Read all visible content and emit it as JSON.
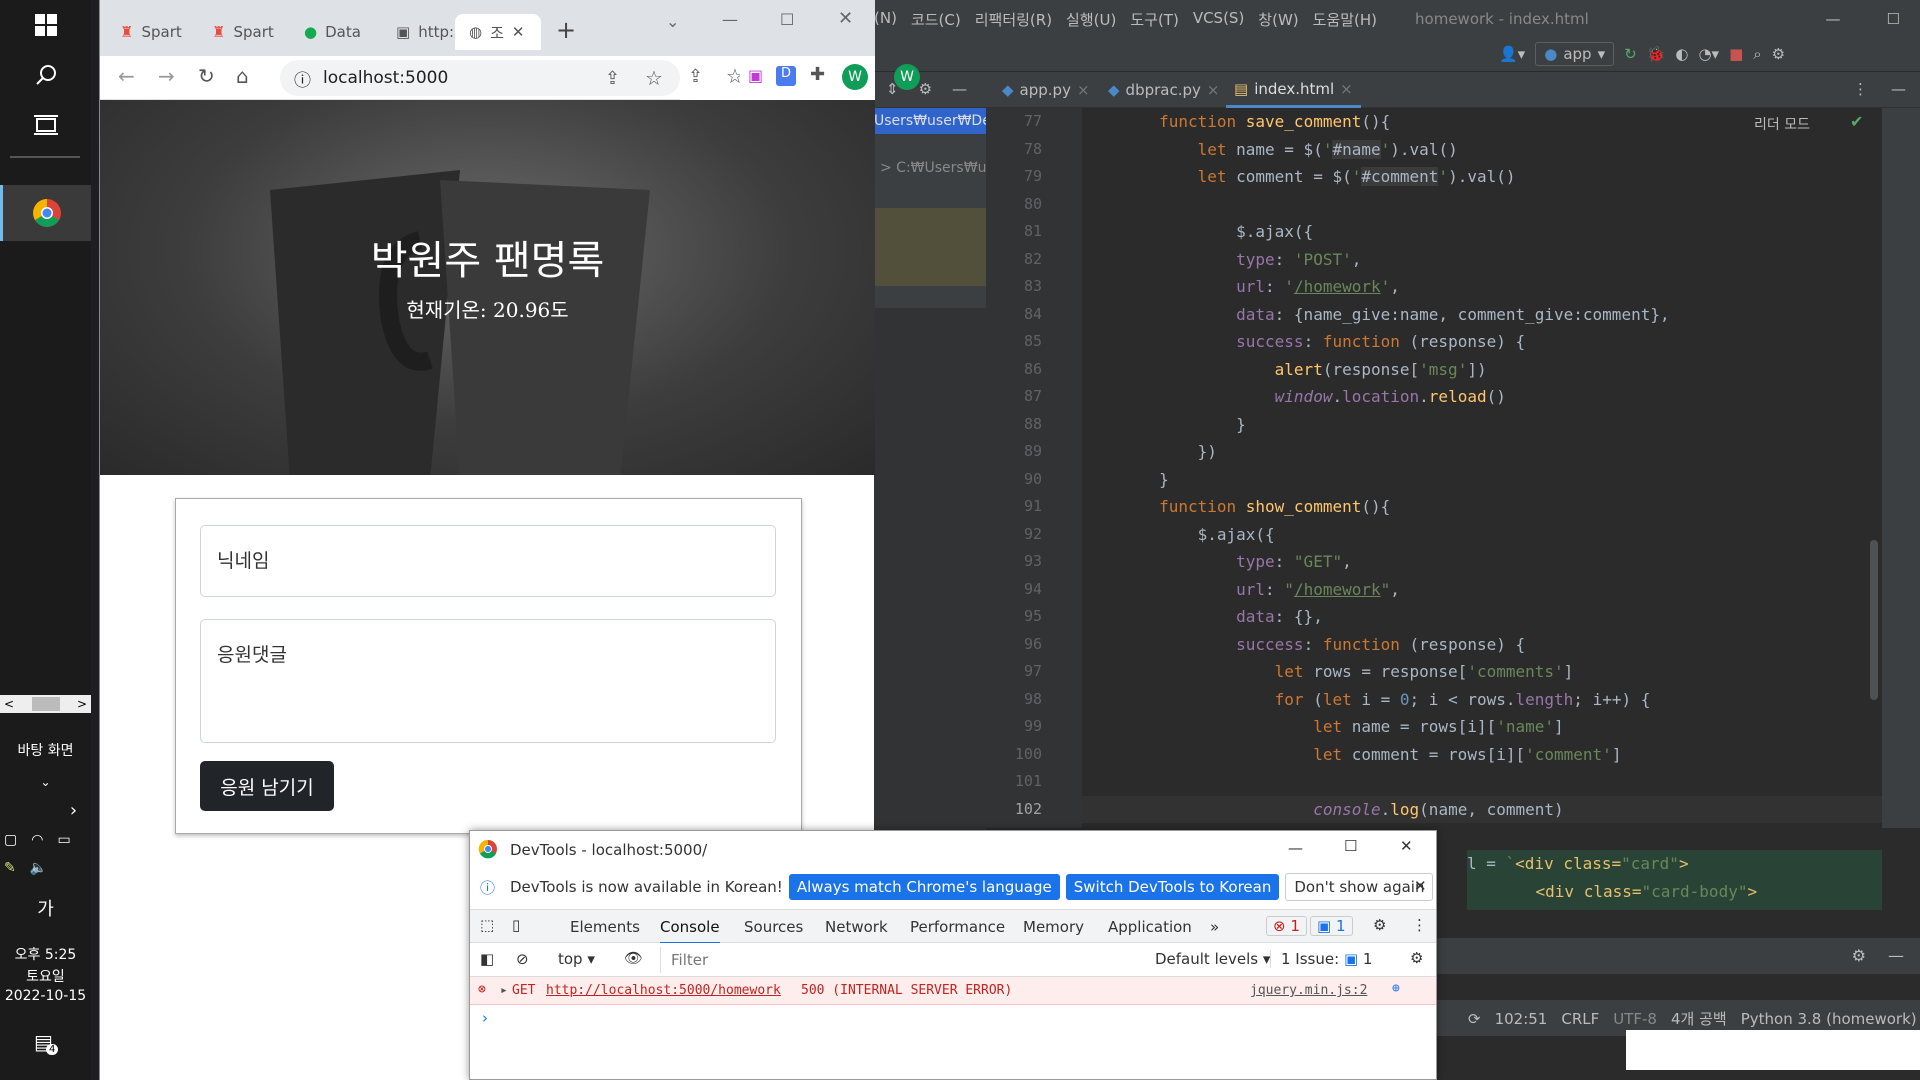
{
  "taskbar": {
    "desktop_label": "바탕 화면",
    "ime": "가",
    "time": "오후 5:25",
    "day": "토요일",
    "date": "2022-10-15",
    "notif_count": "4"
  },
  "chrome": {
    "tabs": [
      {
        "label": "Spart",
        "icon": "sparta-icon"
      },
      {
        "label": "Spart",
        "icon": "sparta-icon"
      },
      {
        "label": "Data",
        "icon": "mongodb-icon"
      },
      {
        "label": "http:",
        "icon": "terminal-icon"
      },
      {
        "label": "조",
        "icon": "globe-icon",
        "active": true
      }
    ],
    "url": "localhost:5000",
    "profile_initial": "W",
    "page": {
      "title": "박원주 팬명록",
      "weather": "현재기온: 20.96도",
      "nickname_placeholder": "닉네임",
      "comment_placeholder": "응원댓글",
      "submit_label": "응원 남기기"
    }
  },
  "ide": {
    "menu": [
      "(N)",
      "코드(C)",
      "리팩터링(R)",
      "실행(U)",
      "도구(T)",
      "VCS(S)",
      "창(W)",
      "도움말(H)"
    ],
    "window_title": "homework - index.html",
    "run_config": "app",
    "tabs": [
      "app.py",
      "dbprac.py",
      "index.html"
    ],
    "reader_mode": "리더 모드",
    "project_path1": "Users₩user₩Des",
    "project_path2": "> C:₩Users₩us",
    "line_numbers": [
      "77",
      "78",
      "79",
      "80",
      "81",
      "82",
      "83",
      "84",
      "85",
      "86",
      "87",
      "88",
      "89",
      "90",
      "91",
      "92",
      "93",
      "94",
      "95",
      "96",
      "97",
      "98",
      "99",
      "100",
      "101",
      "102"
    ],
    "status": {
      "position": "102:51",
      "line_sep": "CRLF",
      "encoding": "UTF-8",
      "indent": "4개 공백",
      "interpreter": "Python 3.8 (homework)"
    }
  },
  "devtools": {
    "title": "DevTools - localhost:5000/",
    "info_text": "DevTools is now available in Korean!",
    "btn_match": "Always match Chrome's language",
    "btn_switch": "Switch DevTools to Korean",
    "btn_dont": "Don't show again",
    "tabs": [
      "Elements",
      "Console",
      "Sources",
      "Network",
      "Performance",
      "Memory",
      "Application"
    ],
    "err_count": "1",
    "msg_count": "1",
    "context": "top",
    "filter_placeholder": "Filter",
    "levels": "Default levels",
    "issues": "1 Issue:",
    "issue_count": "1",
    "error_method": "GET",
    "error_url": "http://localhost:5000/homework",
    "error_status": "500 (INTERNAL SERVER ERROR)",
    "error_source": "jquery.min.js:2"
  },
  "colors": {
    "chrome_tabbar": "#dee1e6",
    "ide_bg": "#2b2b2b",
    "dt_button": "#1a73e8",
    "error_red": "#c5221f"
  }
}
